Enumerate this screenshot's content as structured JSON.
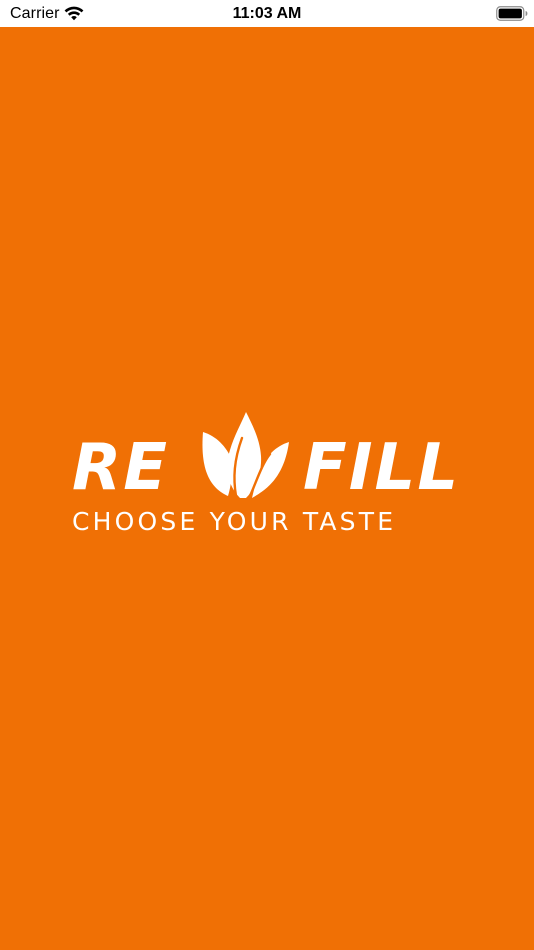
{
  "status_bar": {
    "carrier": "Carrier",
    "time": "11:03 AM",
    "wifi_icon": "wifi-icon",
    "battery_icon": "battery-full-icon"
  },
  "splash": {
    "background_color": "#f07005",
    "logo": {
      "word_left": "RE",
      "word_right": "FILL",
      "mark_icon": "leaf-icon",
      "tagline": "CHOOSE YOUR TASTE",
      "color": "#ffffff"
    }
  }
}
